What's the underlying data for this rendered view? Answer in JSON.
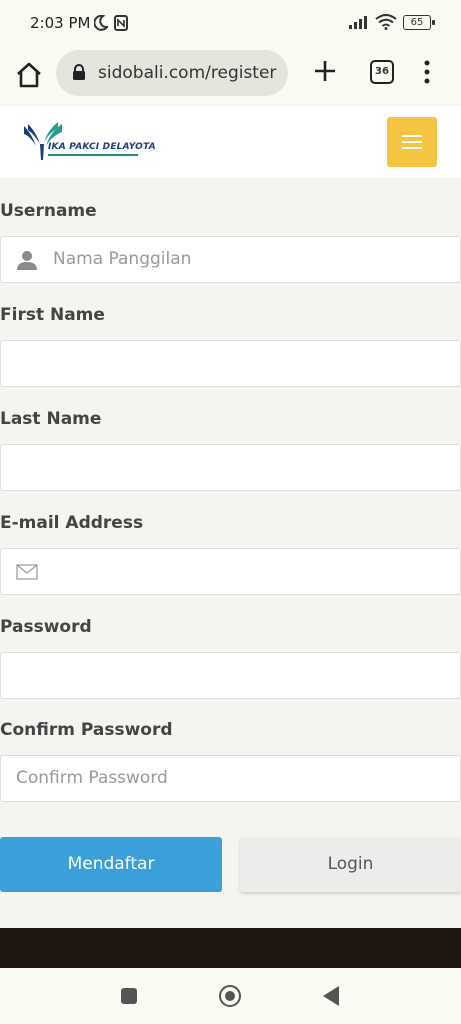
{
  "status": {
    "time": "2:03 PM",
    "battery": "65"
  },
  "browser": {
    "url": "sidobali.com/register",
    "tab_count": "36"
  },
  "site": {
    "logo_text": "IKA PAKCI DELAYOTA"
  },
  "form": {
    "username": {
      "label": "Username",
      "placeholder": "Nama Panggilan"
    },
    "first_name": {
      "label": "First Name"
    },
    "last_name": {
      "label": "Last Name"
    },
    "email": {
      "label": "E-mail Address"
    },
    "password": {
      "label": "Password"
    },
    "confirm_password": {
      "label": "Confirm Password",
      "placeholder": "Confirm Password"
    },
    "submit_label": "Mendaftar",
    "login_label": "Login"
  },
  "colors": {
    "accent": "#3b9fda",
    "menu_button": "#f4c542",
    "footer": "#1f1712"
  }
}
